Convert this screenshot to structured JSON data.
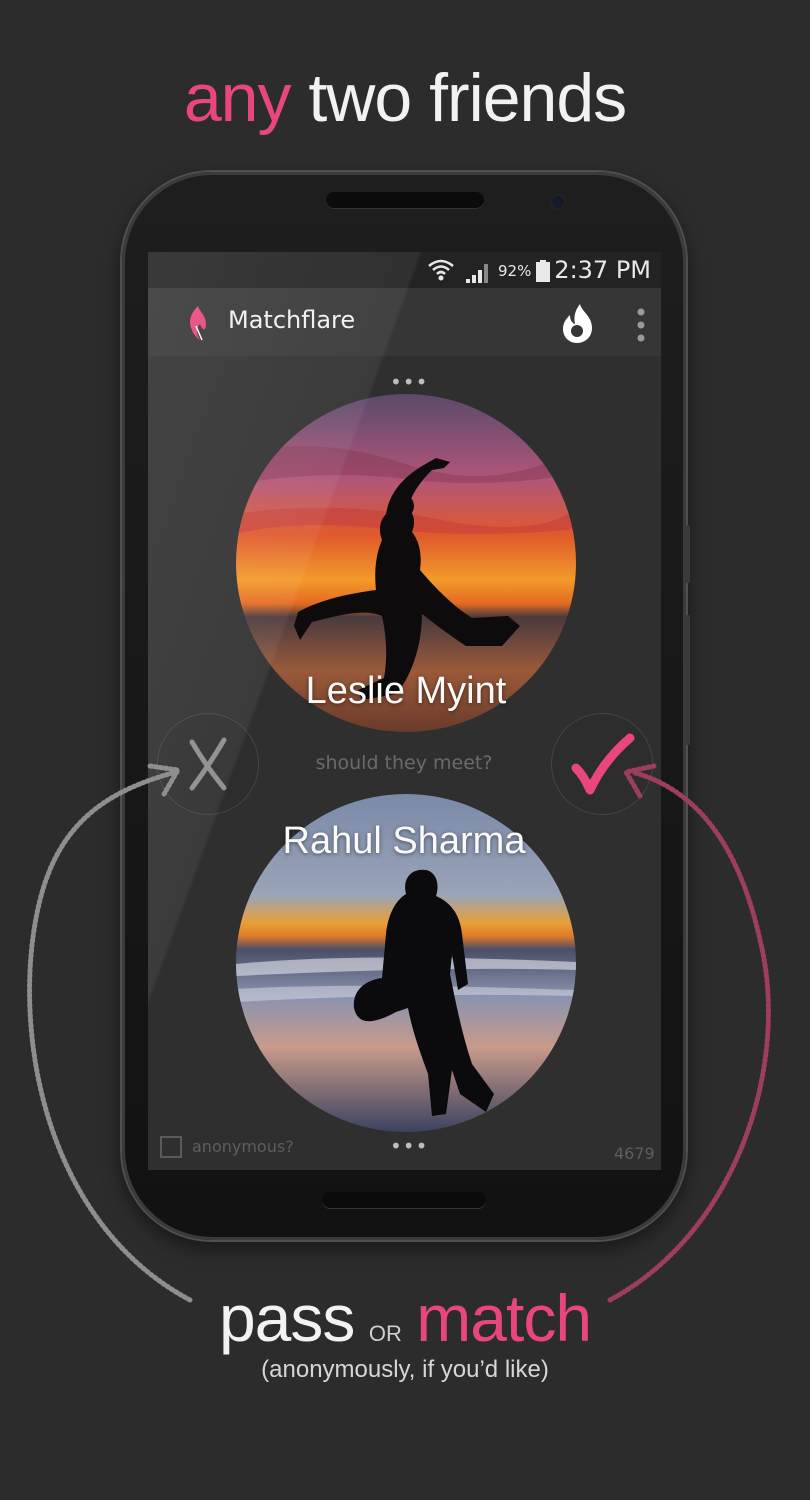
{
  "headline": {
    "part1": "any",
    "part2": "two friends"
  },
  "status_bar": {
    "battery": "92%",
    "time": "2:37 PM"
  },
  "app_bar": {
    "title": "Matchflare"
  },
  "match": {
    "person_top": "Leslie Myint",
    "person_bottom": "Rahul Sharma",
    "question": "should they meet?",
    "pass_symbol": "X",
    "match_symbol": "✓",
    "dots": "•••"
  },
  "footer": {
    "anonymous_label": "anonymous?",
    "counter": "4679"
  },
  "bottom": {
    "pass": "pass",
    "or": "OR",
    "match": "match",
    "subtitle": "(anonymously, if you’d like)"
  },
  "colors": {
    "accent": "#e9467d",
    "background": "#2c2c2c"
  }
}
